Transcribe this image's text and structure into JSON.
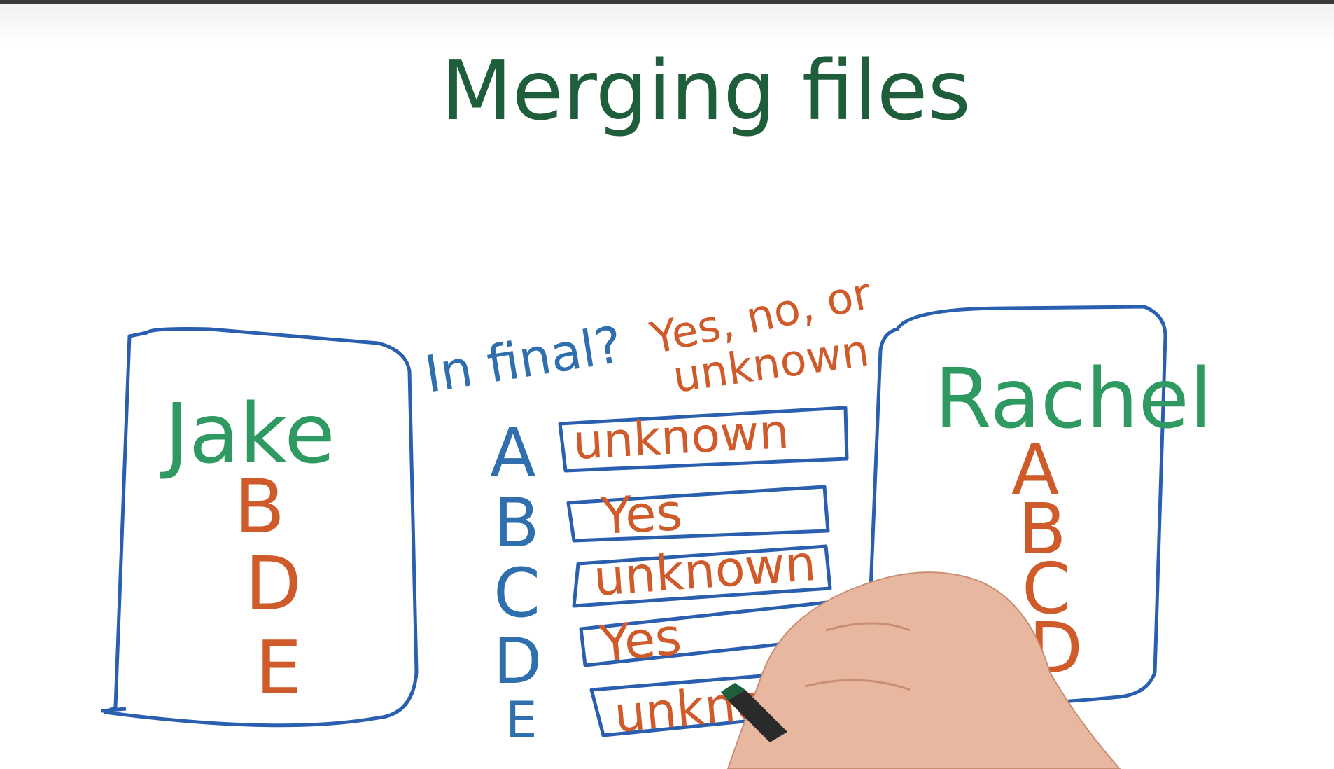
{
  "title": "Merging files",
  "question": {
    "prefix": "In final?",
    "options_line1": "Yes, no, or",
    "options_line2": "unknown"
  },
  "jake": {
    "name": "Jake",
    "files": [
      "B",
      "D",
      "E"
    ]
  },
  "rachel": {
    "name": "Rachel",
    "files": [
      "A",
      "B",
      "C",
      "D"
    ]
  },
  "rows": [
    {
      "letter": "A",
      "answer": "unknown"
    },
    {
      "letter": "B",
      "answer": "Yes"
    },
    {
      "letter": "C",
      "answer": "unknown"
    },
    {
      "letter": "D",
      "answer": "Yes"
    },
    {
      "letter": "E",
      "answer": "unknown"
    }
  ],
  "colors": {
    "title": "#1f5e3b",
    "box": "#2a5fb0",
    "name": "#2e9a62",
    "file": "#cf5a2a",
    "question": "#2f6fae"
  }
}
